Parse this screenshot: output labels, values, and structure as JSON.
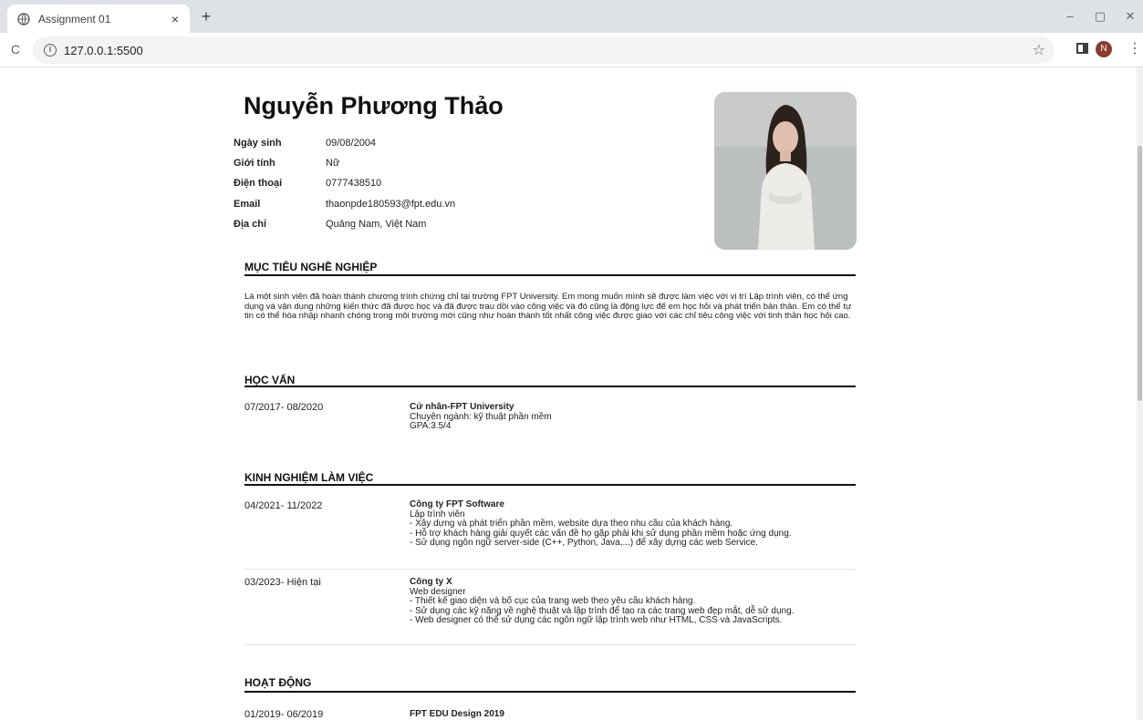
{
  "browser": {
    "tab_title": "Assignment 01",
    "tab_close": "×",
    "new_tab": "+",
    "url": "127.0.0.1:5500",
    "profile_initial": "N",
    "reload_glyph": "C",
    "minimize": "–",
    "restore": "▢",
    "close": "✕"
  },
  "cv": {
    "name": "Nguyễn Phương Thảo",
    "info": [
      {
        "label": "Ngày sinh",
        "value": "09/08/2004"
      },
      {
        "label": "Giới tính",
        "value": "Nữ"
      },
      {
        "label": "Điện thoại",
        "value": "0777438510"
      },
      {
        "label": "Email",
        "value": "thaonpde180593@fpt.edu.vn"
      },
      {
        "label": "Địa chỉ",
        "value": "Quảng Nam, Việt Nam"
      }
    ],
    "objective_title": "MỤC TIÊU NGHỀ NGHIỆP",
    "objective_text": "Là một sinh viên đã hoàn thành chương trình chứng chỉ tại trường FPT University. Em mong muốn mình sẽ được làm việc với vị trí Lập trình viên, có thể ứng dụng và vận dụng những kiến thức đã được học và đã được trau dồi vào công việc và đó cũng là động lực để em học hỏi và phát triển bản thân. Em có thể tự tin có thể hòa nhập nhanh chóng trong môi trường mới cũng như hoàn thành tốt nhất công việc được giao với các chỉ tiêu công việc với tinh thần học hỏi cao.",
    "education_title": "HỌC VẤN",
    "education": [
      {
        "date": "07/2017- 08/2020",
        "title": "Cử nhân-FPT University",
        "lines": [
          "Chuyên ngành: kỹ thuật phần mềm",
          "GPA:3.5/4"
        ]
      }
    ],
    "experience_title": "KINH NGHIỆM LÀM VIỆC",
    "experience": [
      {
        "date": "04/2021- 11/2022",
        "title": "Công ty FPT Software",
        "lines": [
          "Lập trình viên",
          "- Xây dựng và phát triển phần mềm, website dựa theo nhu cầu của khách hàng.",
          "- Hỗ trợ khách hàng giải quyết các vấn đề họ gặp phải khi sử dụng phần mềm hoặc ứng dụng.",
          "- Sử dụng ngôn ngữ server-side (C++, Python, Java,...) để xây dựng các web Service."
        ]
      },
      {
        "date": "03/2023- Hiện tại",
        "title": "Công ty X",
        "lines": [
          "Web designer",
          "- Thiết kế giao diện và bố cục của trang web theo yêu cầu khách hàng.",
          "- Sử dụng các kỹ năng về nghệ thuật và lập trình để tạo ra các trang web đẹp mắt, dễ sử dụng.",
          "- Web designer có thể sử dụng các ngôn ngữ lập trình web như HTML, CSS và JavaScripts."
        ]
      }
    ],
    "activity_title": "HOẠT ĐỘNG",
    "activities": [
      {
        "date": "01/2019- 06/2019",
        "title": "FPT EDU Design 2019"
      }
    ]
  }
}
